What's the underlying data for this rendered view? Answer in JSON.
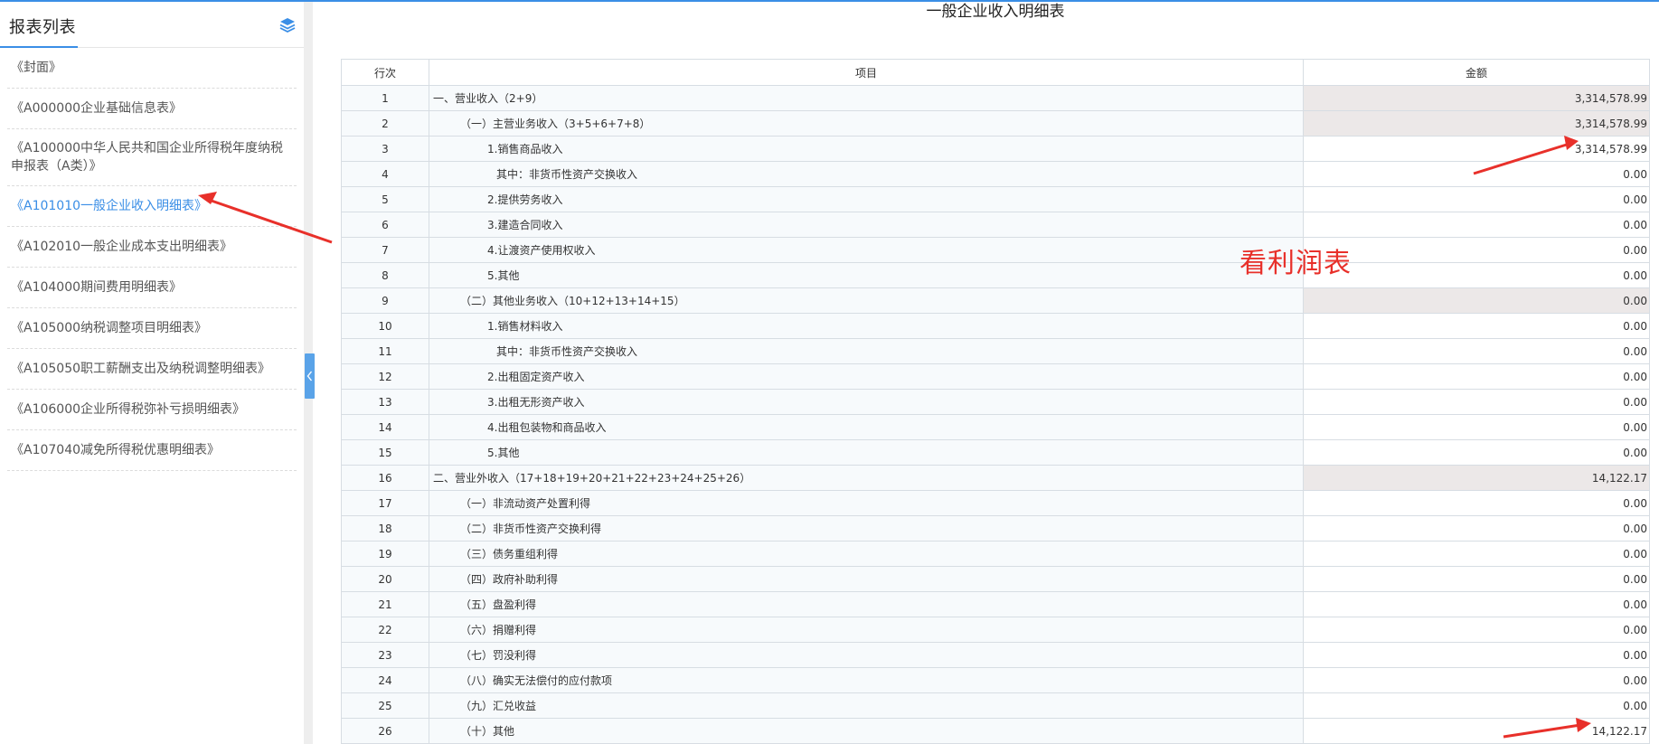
{
  "sidebar": {
    "title": "报表列表",
    "items": [
      {
        "label": "《封面》",
        "active": false
      },
      {
        "label": "《A000000企业基础信息表》",
        "active": false
      },
      {
        "label": "《A100000中华人民共和国企业所得税年度纳税申报表（A类）》",
        "active": false
      },
      {
        "label": "《A101010一般企业收入明细表》",
        "active": true
      },
      {
        "label": "《A102010一般企业成本支出明细表》",
        "active": false
      },
      {
        "label": "《A104000期间费用明细表》",
        "active": false
      },
      {
        "label": "《A105000纳税调整项目明细表》",
        "active": false
      },
      {
        "label": "《A105050职工薪酬支出及纳税调整明细表》",
        "active": false
      },
      {
        "label": "《A106000企业所得税弥补亏损明细表》",
        "active": false
      },
      {
        "label": "《A107040减免所得税优惠明细表》",
        "active": false
      }
    ]
  },
  "main": {
    "title": "一般企业收入明细表",
    "annotation": "看利润表",
    "table": {
      "headers": {
        "row_no": "行次",
        "item": "项目",
        "amount": "金额"
      },
      "rows": [
        {
          "no": "1",
          "item": "一、营业收入（2+9）",
          "amount": "3,314,578.99",
          "level": 0,
          "shaded": true
        },
        {
          "no": "2",
          "item": "（一）主营业务收入（3+5+6+7+8）",
          "amount": "3,314,578.99",
          "level": 1,
          "shaded": true
        },
        {
          "no": "3",
          "item": "1.销售商品收入",
          "amount": "3,314,578.99",
          "level": 2,
          "shaded": false
        },
        {
          "no": "4",
          "item": "其中：非货币性资产交换收入",
          "amount": "0.00",
          "level": 3,
          "shaded": false
        },
        {
          "no": "5",
          "item": "2.提供劳务收入",
          "amount": "0.00",
          "level": 2,
          "shaded": false
        },
        {
          "no": "6",
          "item": "3.建造合同收入",
          "amount": "0.00",
          "level": 2,
          "shaded": false
        },
        {
          "no": "7",
          "item": "4.让渡资产使用权收入",
          "amount": "0.00",
          "level": 2,
          "shaded": false
        },
        {
          "no": "8",
          "item": "5.其他",
          "amount": "0.00",
          "level": 2,
          "shaded": false
        },
        {
          "no": "9",
          "item": "（二）其他业务收入（10+12+13+14+15）",
          "amount": "0.00",
          "level": 1,
          "shaded": true
        },
        {
          "no": "10",
          "item": "1.销售材料收入",
          "amount": "0.00",
          "level": 2,
          "shaded": false
        },
        {
          "no": "11",
          "item": "其中：非货币性资产交换收入",
          "amount": "0.00",
          "level": 3,
          "shaded": false
        },
        {
          "no": "12",
          "item": "2.出租固定资产收入",
          "amount": "0.00",
          "level": 2,
          "shaded": false
        },
        {
          "no": "13",
          "item": "3.出租无形资产收入",
          "amount": "0.00",
          "level": 2,
          "shaded": false
        },
        {
          "no": "14",
          "item": "4.出租包装物和商品收入",
          "amount": "0.00",
          "level": 2,
          "shaded": false
        },
        {
          "no": "15",
          "item": "5.其他",
          "amount": "0.00",
          "level": 2,
          "shaded": false
        },
        {
          "no": "16",
          "item": "二、营业外收入（17+18+19+20+21+22+23+24+25+26）",
          "amount": "14,122.17",
          "level": 0,
          "shaded": true
        },
        {
          "no": "17",
          "item": "（一）非流动资产处置利得",
          "amount": "0.00",
          "level": 1,
          "shaded": false
        },
        {
          "no": "18",
          "item": "（二）非货币性资产交换利得",
          "amount": "0.00",
          "level": 1,
          "shaded": false
        },
        {
          "no": "19",
          "item": "（三）债务重组利得",
          "amount": "0.00",
          "level": 1,
          "shaded": false
        },
        {
          "no": "20",
          "item": "（四）政府补助利得",
          "amount": "0.00",
          "level": 1,
          "shaded": false
        },
        {
          "no": "21",
          "item": "（五）盘盈利得",
          "amount": "0.00",
          "level": 1,
          "shaded": false
        },
        {
          "no": "22",
          "item": "（六）捐赠利得",
          "amount": "0.00",
          "level": 1,
          "shaded": false
        },
        {
          "no": "23",
          "item": "（七）罚没利得",
          "amount": "0.00",
          "level": 1,
          "shaded": false
        },
        {
          "no": "24",
          "item": "（八）确实无法偿付的应付款项",
          "amount": "0.00",
          "level": 1,
          "shaded": false
        },
        {
          "no": "25",
          "item": "（九）汇兑收益",
          "amount": "0.00",
          "level": 1,
          "shaded": false
        },
        {
          "no": "26",
          "item": "（十）其他",
          "amount": "14,122.17",
          "level": 1,
          "shaded": false
        }
      ]
    }
  },
  "colors": {
    "accent": "#3a8ee6",
    "annotation_red": "#e8302a",
    "shaded_cell": "#ece8e8"
  },
  "icons": {
    "sidebar_header": "layers-icon",
    "collapse_handle": "chevron-left-icon",
    "annotations": "red-arrow-icon"
  }
}
